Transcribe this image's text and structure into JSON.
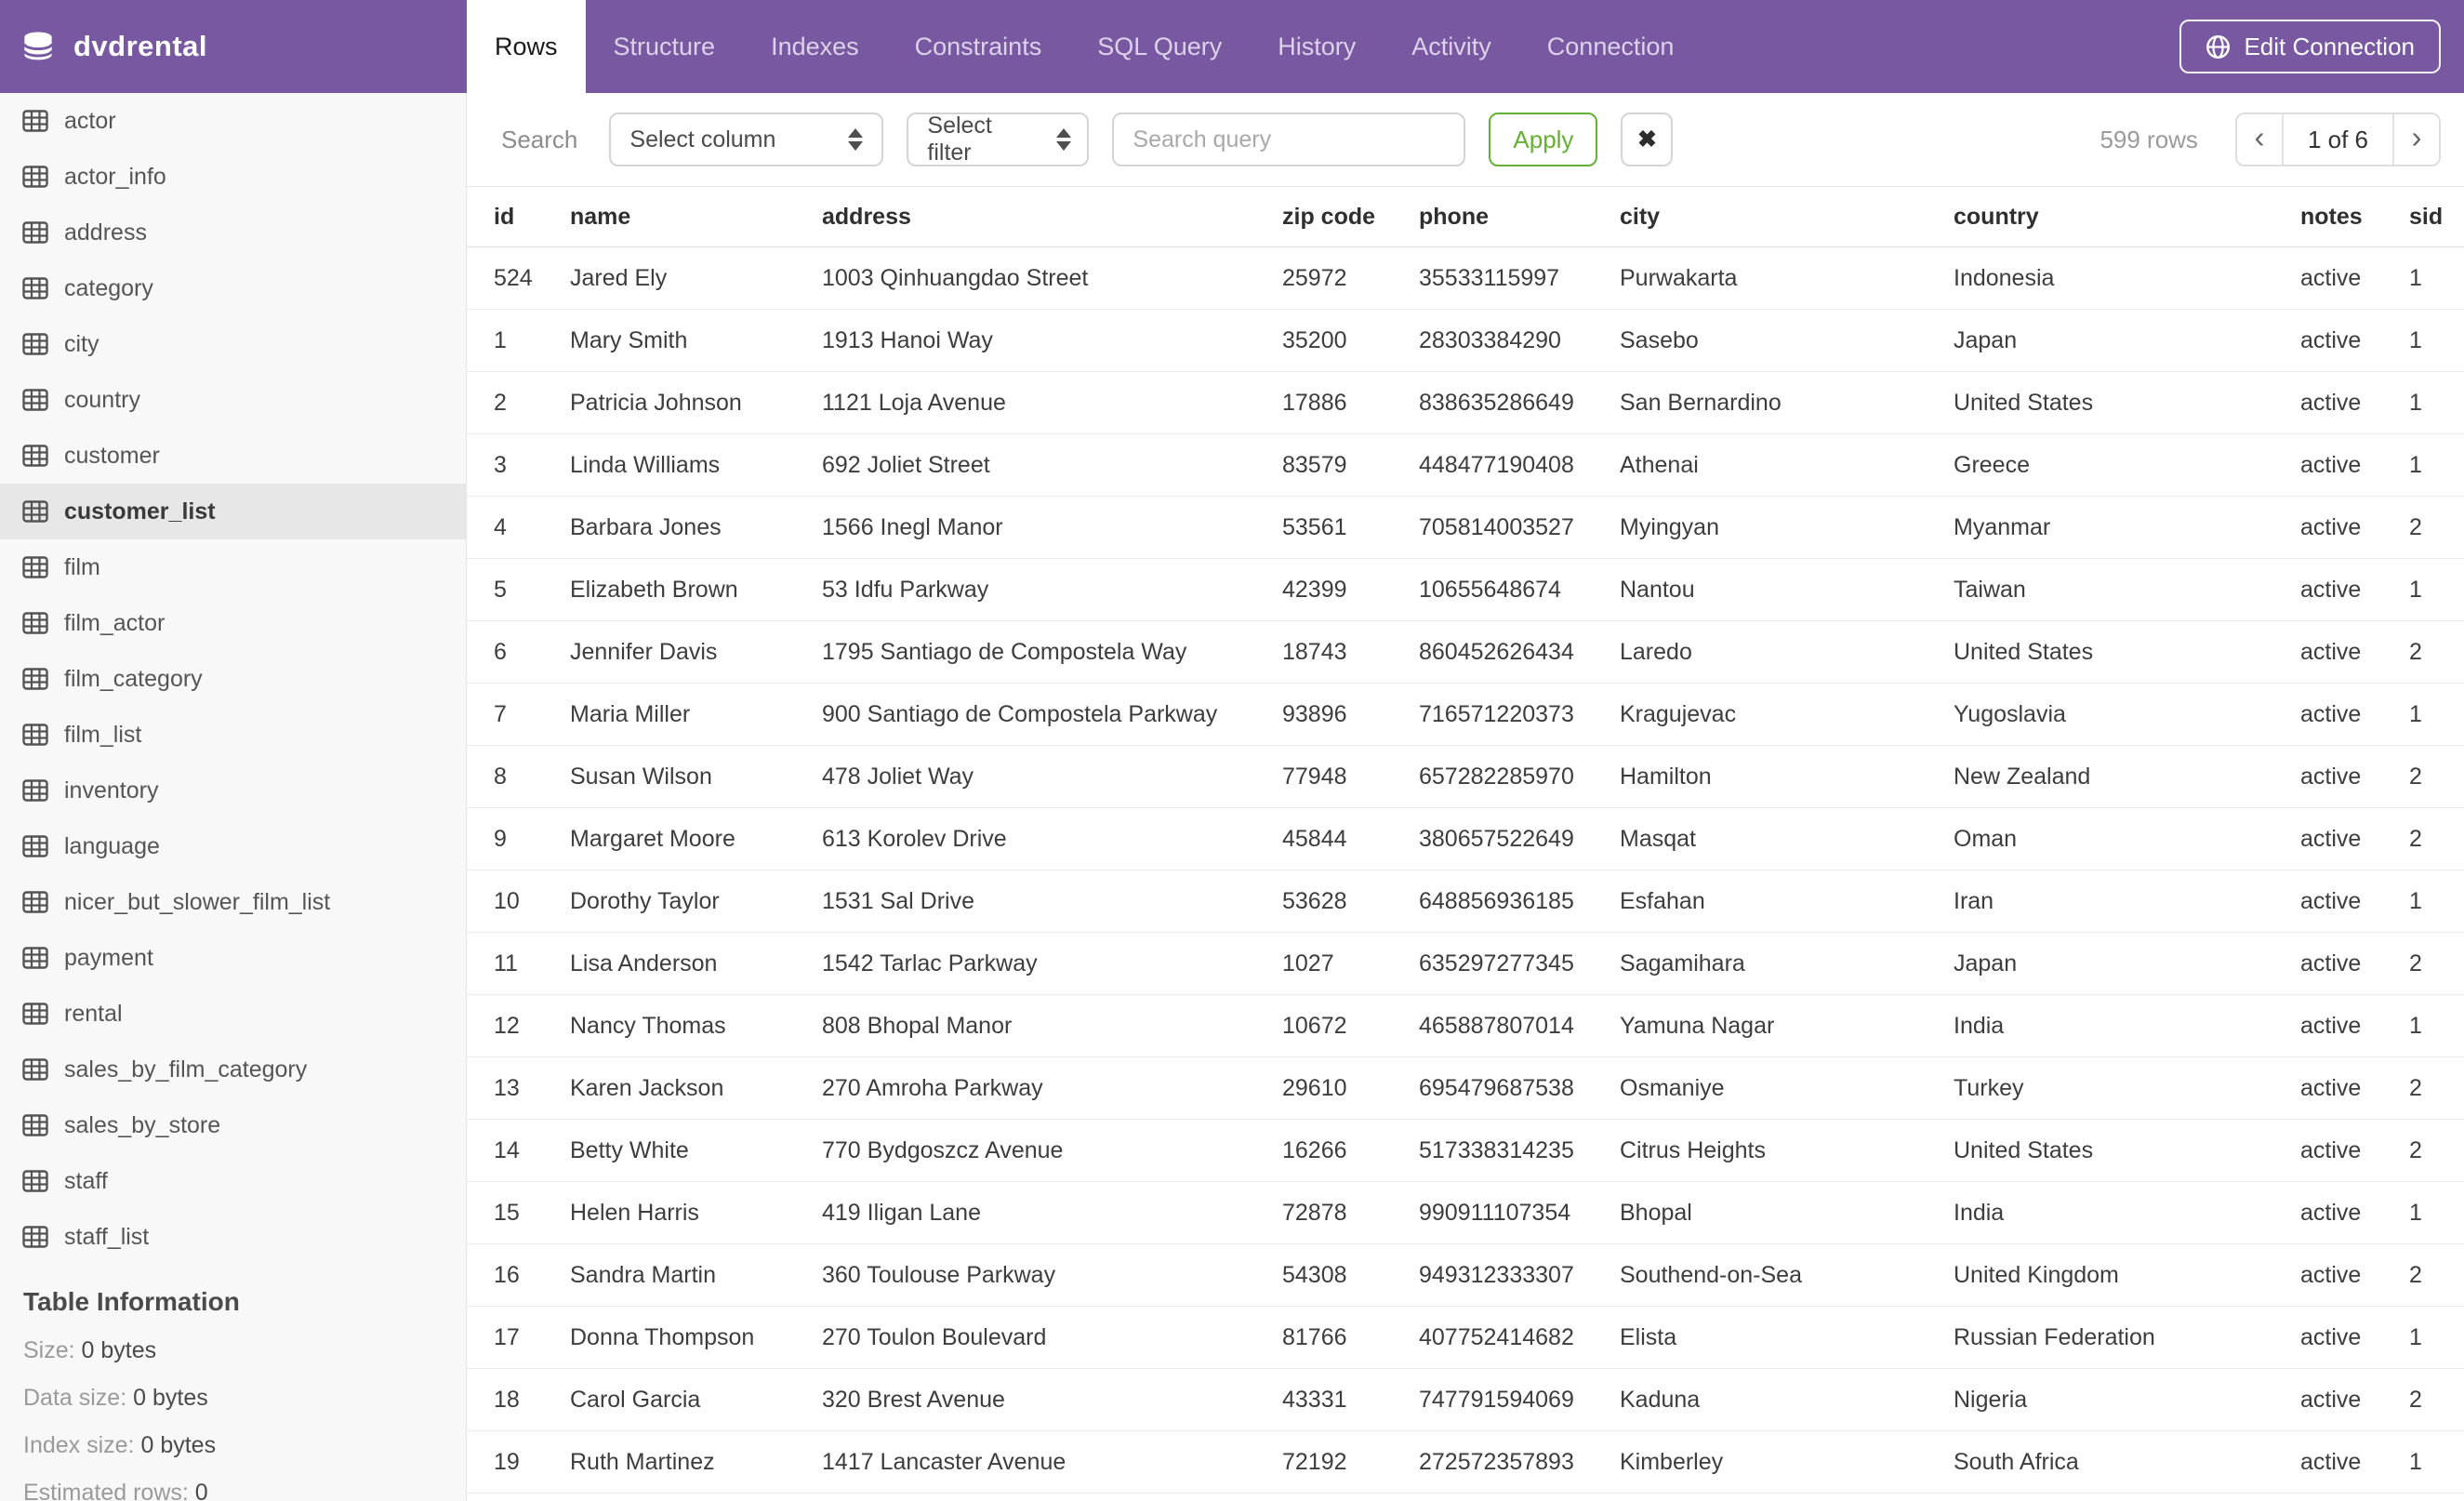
{
  "header": {
    "database_name": "dvdrental",
    "tabs": [
      {
        "label": "Rows",
        "active": true
      },
      {
        "label": "Structure",
        "active": false
      },
      {
        "label": "Indexes",
        "active": false
      },
      {
        "label": "Constraints",
        "active": false
      },
      {
        "label": "SQL Query",
        "active": false
      },
      {
        "label": "History",
        "active": false
      },
      {
        "label": "Activity",
        "active": false
      },
      {
        "label": "Connection",
        "active": false
      }
    ],
    "edit_connection_label": "Edit Connection"
  },
  "sidebar": {
    "tables": [
      "actor",
      "actor_info",
      "address",
      "category",
      "city",
      "country",
      "customer",
      "customer_list",
      "film",
      "film_actor",
      "film_category",
      "film_list",
      "inventory",
      "language",
      "nicer_but_slower_film_list",
      "payment",
      "rental",
      "sales_by_film_category",
      "sales_by_store",
      "staff",
      "staff_list"
    ],
    "selected_table": "customer_list",
    "table_information": {
      "heading": "Table Information",
      "items": [
        {
          "label": "Size:",
          "value": "0 bytes"
        },
        {
          "label": "Data size:",
          "value": "0 bytes"
        },
        {
          "label": "Index size:",
          "value": "0 bytes"
        },
        {
          "label": "Estimated rows:",
          "value": "0"
        }
      ]
    }
  },
  "toolbar": {
    "search_label": "Search",
    "column_select_value": "Select column",
    "filter_select_value": "Select filter",
    "query_placeholder": "Search query",
    "query_value": "",
    "apply_label": "Apply",
    "clear_label": "✖",
    "rows_count": "599 rows",
    "pagination": {
      "prev": "‹",
      "current": "1 of 6",
      "next": "›"
    }
  },
  "table": {
    "columns": [
      "id",
      "name",
      "address",
      "zip code",
      "phone",
      "city",
      "country",
      "notes",
      "sid"
    ],
    "rows": [
      [
        "524",
        "Jared Ely",
        "1003 Qinhuangdao Street",
        "25972",
        "35533115997",
        "Purwakarta",
        "Indonesia",
        "active",
        "1"
      ],
      [
        "1",
        "Mary Smith",
        "1913 Hanoi Way",
        "35200",
        "28303384290",
        "Sasebo",
        "Japan",
        "active",
        "1"
      ],
      [
        "2",
        "Patricia Johnson",
        "1121 Loja Avenue",
        "17886",
        "838635286649",
        "San Bernardino",
        "United States",
        "active",
        "1"
      ],
      [
        "3",
        "Linda Williams",
        "692 Joliet Street",
        "83579",
        "448477190408",
        "Athenai",
        "Greece",
        "active",
        "1"
      ],
      [
        "4",
        "Barbara Jones",
        "1566 Inegl Manor",
        "53561",
        "705814003527",
        "Myingyan",
        "Myanmar",
        "active",
        "2"
      ],
      [
        "5",
        "Elizabeth Brown",
        "53 Idfu Parkway",
        "42399",
        "10655648674",
        "Nantou",
        "Taiwan",
        "active",
        "1"
      ],
      [
        "6",
        "Jennifer Davis",
        "1795 Santiago de Compostela Way",
        "18743",
        "860452626434",
        "Laredo",
        "United States",
        "active",
        "2"
      ],
      [
        "7",
        "Maria Miller",
        "900 Santiago de Compostela Parkway",
        "93896",
        "716571220373",
        "Kragujevac",
        "Yugoslavia",
        "active",
        "1"
      ],
      [
        "8",
        "Susan Wilson",
        "478 Joliet Way",
        "77948",
        "657282285970",
        "Hamilton",
        "New Zealand",
        "active",
        "2"
      ],
      [
        "9",
        "Margaret Moore",
        "613 Korolev Drive",
        "45844",
        "380657522649",
        "Masqat",
        "Oman",
        "active",
        "2"
      ],
      [
        "10",
        "Dorothy Taylor",
        "1531 Sal Drive",
        "53628",
        "648856936185",
        "Esfahan",
        "Iran",
        "active",
        "1"
      ],
      [
        "11",
        "Lisa Anderson",
        "1542 Tarlac Parkway",
        "1027",
        "635297277345",
        "Sagamihara",
        "Japan",
        "active",
        "2"
      ],
      [
        "12",
        "Nancy Thomas",
        "808 Bhopal Manor",
        "10672",
        "465887807014",
        "Yamuna Nagar",
        "India",
        "active",
        "1"
      ],
      [
        "13",
        "Karen Jackson",
        "270 Amroha Parkway",
        "29610",
        "695479687538",
        "Osmaniye",
        "Turkey",
        "active",
        "2"
      ],
      [
        "14",
        "Betty White",
        "770 Bydgoszcz Avenue",
        "16266",
        "517338314235",
        "Citrus Heights",
        "United States",
        "active",
        "2"
      ],
      [
        "15",
        "Helen Harris",
        "419 Iligan Lane",
        "72878",
        "990911107354",
        "Bhopal",
        "India",
        "active",
        "1"
      ],
      [
        "16",
        "Sandra Martin",
        "360 Toulouse Parkway",
        "54308",
        "949312333307",
        "Southend-on-Sea",
        "United Kingdom",
        "active",
        "2"
      ],
      [
        "17",
        "Donna Thompson",
        "270 Toulon Boulevard",
        "81766",
        "407752414682",
        "Elista",
        "Russian Federation",
        "active",
        "1"
      ],
      [
        "18",
        "Carol Garcia",
        "320 Brest Avenue",
        "43331",
        "747791594069",
        "Kaduna",
        "Nigeria",
        "active",
        "2"
      ],
      [
        "19",
        "Ruth Martinez",
        "1417 Lancaster Avenue",
        "72192",
        "272572357893",
        "Kimberley",
        "South Africa",
        "active",
        "1"
      ]
    ]
  },
  "colors": {
    "header_purple": "#7859a1",
    "apply_green": "#64b133",
    "selected_table_bg": "#e7e7e7"
  }
}
